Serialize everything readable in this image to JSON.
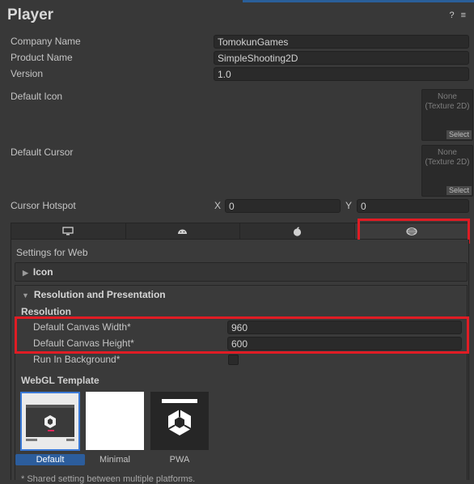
{
  "header": {
    "title": "Player",
    "help_icon": "?",
    "settings_icon": "≡"
  },
  "fields": {
    "company_label": "Company Name",
    "company_value": "TomokunGames",
    "product_label": "Product Name",
    "product_value": "SimpleShooting2D",
    "version_label": "Version",
    "version_value": "1.0",
    "icon_label": "Default Icon",
    "cursor_label": "Default Cursor",
    "none_text": "None",
    "type_text": "(Texture 2D)",
    "select_text": "Select",
    "hotspot_label": "Cursor Hotspot",
    "x_label": "X",
    "x_value": "0",
    "y_label": "Y",
    "y_value": "0"
  },
  "platform_tabs": [
    "Standalone",
    "Android",
    "iOS",
    "WebGL"
  ],
  "web": {
    "settings_title": "Settings for Web",
    "icon_section": "Icon",
    "res_section": "Resolution and Presentation",
    "resolution_label": "Resolution",
    "width_label": "Default Canvas Width*",
    "width_value": "960",
    "height_label": "Default Canvas Height*",
    "height_value": "600",
    "run_bg_label": "Run In Background*",
    "template_label": "WebGL Template",
    "templates": [
      "Default",
      "Minimal",
      "PWA"
    ],
    "footnote": "* Shared setting between multiple platforms."
  },
  "colors": {
    "highlight": "#e01c24",
    "selection": "#2c5d9c"
  }
}
